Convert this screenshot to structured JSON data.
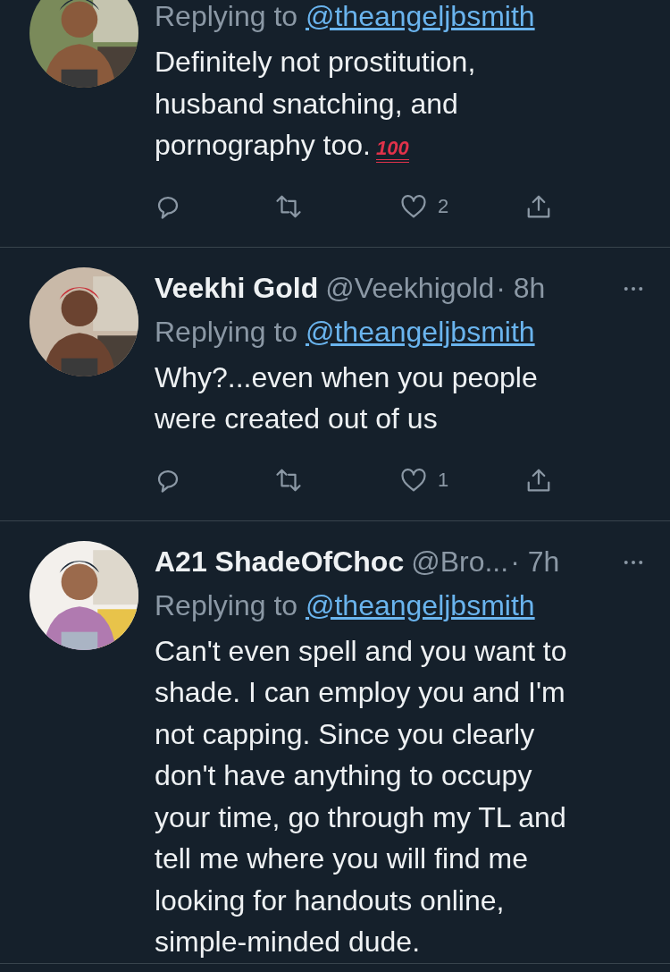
{
  "tweets": [
    {
      "replying_label": "Replying to",
      "replying_handle": "@theangeljbsmith",
      "text": "Definitely not prostitution, husband snatching, and pornography too.",
      "emoji": "100",
      "actions": {
        "likes": "2"
      }
    },
    {
      "name": "Veekhi Gold",
      "handle": "@Veekhigold",
      "time": "· 8h",
      "replying_label": "Replying to",
      "replying_handle": "@theangeljbsmith",
      "text": "Why?...even when you people were created out of us",
      "actions": {
        "likes": "1"
      }
    },
    {
      "name": "A21 ShadeOfChoc",
      "handle": "@Bro...",
      "time": "· 7h",
      "replying_label": "Replying to",
      "replying_handle": "@theangeljbsmith",
      "text": "Can't even spell and you want to shade. I can employ you and I'm not capping. Since you clearly don't have anything to occupy your time, go through my TL and tell me where you will find me looking for handouts online, simple-minded dude."
    }
  ]
}
